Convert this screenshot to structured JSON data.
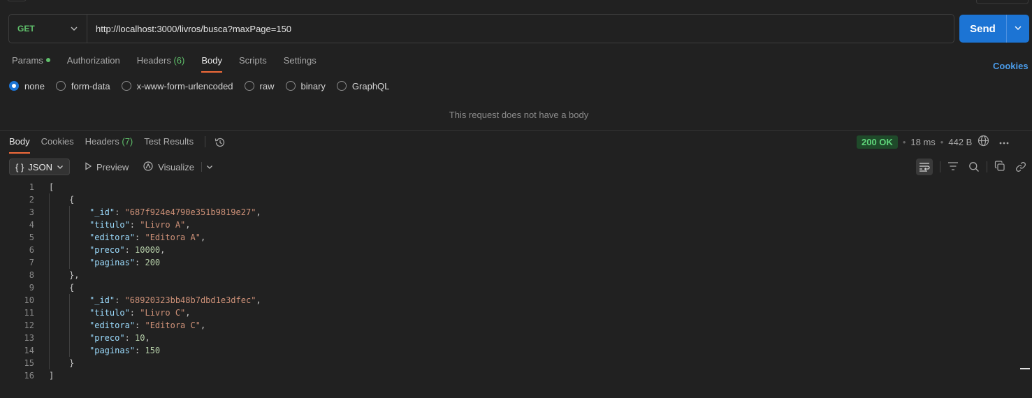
{
  "request": {
    "method": "GET",
    "url": "http://localhost:3000/livros/busca?maxPage=150",
    "send_label": "Send",
    "tabs": [
      {
        "label": "Params"
      },
      {
        "label": "Authorization"
      },
      {
        "label": "Headers",
        "count": "(6)"
      },
      {
        "label": "Body"
      },
      {
        "label": "Scripts"
      },
      {
        "label": "Settings"
      }
    ],
    "cookies_label": "Cookies",
    "body_types": [
      "none",
      "form-data",
      "x-www-form-urlencoded",
      "raw",
      "binary",
      "GraphQL"
    ],
    "selected_body_type": "none",
    "no_body_message": "This request does not have a body"
  },
  "response": {
    "tabs": [
      {
        "label": "Body"
      },
      {
        "label": "Cookies"
      },
      {
        "label": "Headers",
        "count": "(7)"
      },
      {
        "label": "Test Results"
      }
    ],
    "status": "200 OK",
    "time": "18 ms",
    "size": "442 B",
    "format": "JSON",
    "preview_label": "Preview",
    "visualize_label": "Visualize",
    "format_brace": "{ }",
    "line_numbers": [
      "1",
      "2",
      "3",
      "4",
      "5",
      "6",
      "7",
      "8",
      "9",
      "10",
      "11",
      "12",
      "13",
      "14",
      "15",
      "16"
    ],
    "code": {
      "open_bracket": "[",
      "close_bracket": "]",
      "open_brace": "{",
      "close_brace_comma": "},",
      "close_brace": "}",
      "records": [
        {
          "_id_key": "\"_id\"",
          "_id": "\"687f924e4790e351b9819e27\"",
          "titulo_key": "\"titulo\"",
          "titulo": "\"Livro A\"",
          "editora_key": "\"editora\"",
          "editora": "\"Editora A\"",
          "preco_key": "\"preco\"",
          "preco": "10000",
          "paginas_key": "\"paginas\"",
          "paginas": "200"
        },
        {
          "_id_key": "\"_id\"",
          "_id": "\"68920323bb48b7dbd1e3dfec\"",
          "titulo_key": "\"titulo\"",
          "titulo": "\"Livro C\"",
          "editora_key": "\"editora\"",
          "editora": "\"Editora C\"",
          "preco_key": "\"preco\"",
          "preco": "10",
          "paginas_key": "\"paginas\"",
          "paginas": "150"
        }
      ]
    }
  },
  "icons": {
    "method_chevron": "chevron-down-icon",
    "send_chevron": "chevron-down-icon",
    "history": "history-icon",
    "globe": "globe-icon",
    "more": "more-icon",
    "wrap": "wrap-lines-icon",
    "filter": "filter-icon",
    "search": "search-icon",
    "copy": "copy-icon",
    "link": "link-icon"
  },
  "colors": {
    "accent": "#1c74d4",
    "tab_underline": "#f26b3a",
    "status_ok": "#5fd57a",
    "method_get": "#5fbf6a"
  }
}
